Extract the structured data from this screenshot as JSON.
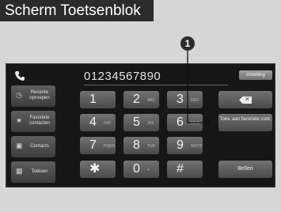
{
  "page_title": "Scherm Toetsenblok",
  "callout_number": "1",
  "screen": {
    "phone_icon": "phone-icon",
    "dialed_number": "01234567890",
    "settings_label": "Instelling",
    "side_buttons": [
      {
        "icon": "recent-calls-icon",
        "label": "Recente oproepen"
      },
      {
        "icon": "star-icon",
        "label": "Favoriete contacten"
      },
      {
        "icon": "contacts-icon",
        "label": "Contacts"
      },
      {
        "icon": "keypad-icon",
        "label": "Toetsen"
      }
    ],
    "keys": [
      {
        "digit": "1",
        "letters": ""
      },
      {
        "digit": "2",
        "letters": "ABC"
      },
      {
        "digit": "3",
        "letters": "DEF"
      },
      {
        "digit": "4",
        "letters": "GHI"
      },
      {
        "digit": "5",
        "letters": "JKL"
      },
      {
        "digit": "6",
        "letters": "MNO"
      },
      {
        "digit": "7",
        "letters": "PQRS"
      },
      {
        "digit": "8",
        "letters": "TUV"
      },
      {
        "digit": "9",
        "letters": "WXYZ"
      },
      {
        "digit": "✱",
        "letters": ""
      },
      {
        "digit": "0",
        "letters": "+"
      },
      {
        "digit": "#",
        "letters": ""
      }
    ],
    "backspace_icon": "backspace-icon",
    "add_favorite_label": "Toev. aan favoriete cont.",
    "call_label": "Bellen"
  }
}
